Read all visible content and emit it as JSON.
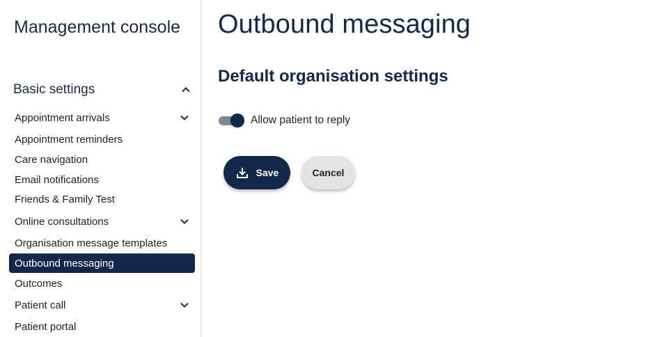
{
  "sidebar": {
    "title": "Management console",
    "section": {
      "label": "Basic settings",
      "icon": "chevron-up-icon"
    },
    "items": [
      {
        "label": "Appointment arrivals",
        "expandable": true
      },
      {
        "label": "Appointment reminders",
        "expandable": false
      },
      {
        "label": "Care navigation",
        "expandable": false
      },
      {
        "label": "Email notifications",
        "expandable": false
      },
      {
        "label": "Friends & Family Test",
        "expandable": false
      },
      {
        "label": "Online consultations",
        "expandable": true
      },
      {
        "label": "Organisation message templates",
        "expandable": false
      },
      {
        "label": "Outbound messaging",
        "expandable": false,
        "active": true
      },
      {
        "label": "Outcomes",
        "expandable": false
      },
      {
        "label": "Patient call",
        "expandable": true
      },
      {
        "label": "Patient portal",
        "expandable": false
      }
    ]
  },
  "main": {
    "title": "Outbound messaging",
    "subtitle": "Default organisation settings",
    "toggle": {
      "label": "Allow patient to reply",
      "checked": true
    },
    "buttons": {
      "save": "Save",
      "cancel": "Cancel"
    }
  },
  "colors": {
    "primary": "#13294b",
    "track": "#7e8596",
    "cancel_bg": "#e3e3e3"
  }
}
